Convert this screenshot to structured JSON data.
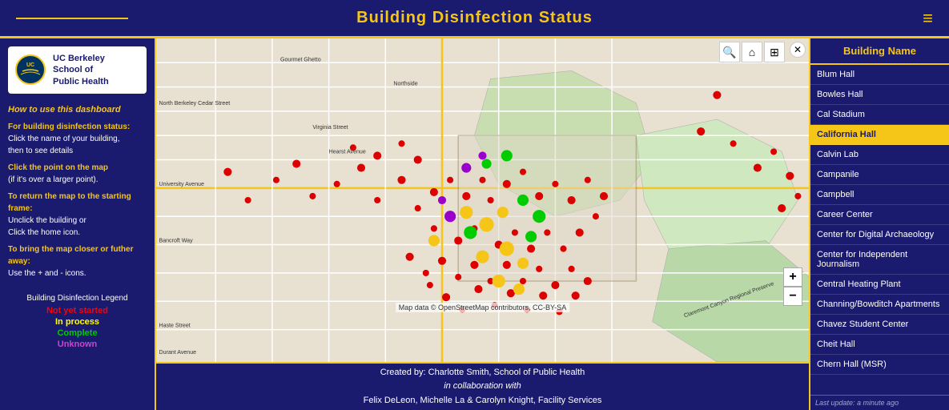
{
  "header": {
    "title": "Building Disinfection Status",
    "hamburger_icon": "≡"
  },
  "left_sidebar": {
    "logo": {
      "line1": "UC Berkeley",
      "line2": "School of",
      "line3": "Public Health"
    },
    "instructions": {
      "heading": "How to use this dashboard",
      "step1_label": "For building disinfection status:",
      "step1_text": "Click the name of  your building,",
      "step1_text2": "then to see details",
      "step2_label": "Click the point on the map",
      "step2_text": "(if it's over a larger point).",
      "step3_label": "To return the map to the starting frame:",
      "step3_text": "Unclick the building or",
      "step3_text2": "Click the home icon.",
      "step4_label": "To bring the map closer or futher away:",
      "step4_text": "Use the + and - icons."
    },
    "legend": {
      "title": "Building Disinfection Legend",
      "items": [
        {
          "label": "Not yet started",
          "color": "red"
        },
        {
          "label": "In process",
          "color": "yellow"
        },
        {
          "label": "Complete",
          "color": "green"
        },
        {
          "label": "Unknown",
          "color": "purple"
        }
      ]
    }
  },
  "map": {
    "attribution": "Map data © OpenStreetMap contributors, CC-BY-SA",
    "zoom_plus": "+",
    "zoom_minus": "−",
    "close_icon": "✕",
    "search_icon": "🔍",
    "home_icon": "⌂",
    "grid_icon": "⊞"
  },
  "footer": {
    "line1": "Created by: Charlotte Smith, School of Public Health",
    "line2": "in collaboration with",
    "line3": "Felix DeLeon, Michelle La & Carolyn Knight, Facility Services"
  },
  "right_sidebar": {
    "header": "Building Name",
    "buildings": [
      {
        "name": "Blum Hall",
        "highlighted": false
      },
      {
        "name": "Bowles Hall",
        "highlighted": false
      },
      {
        "name": "Cal Stadium",
        "highlighted": false
      },
      {
        "name": "California Hall",
        "highlighted": true
      },
      {
        "name": "Calvin Lab",
        "highlighted": false
      },
      {
        "name": "Campanile",
        "highlighted": false
      },
      {
        "name": "Campbell",
        "highlighted": false
      },
      {
        "name": "Career Center",
        "highlighted": false
      },
      {
        "name": "Center for Digital Archaeology",
        "highlighted": false
      },
      {
        "name": "Center for Independent Journalism",
        "highlighted": false
      },
      {
        "name": "Central Heating Plant",
        "highlighted": false
      },
      {
        "name": "Channing/Bowditch Apartments",
        "highlighted": false
      },
      {
        "name": "Chavez Student Center",
        "highlighted": false
      },
      {
        "name": "Cheit Hall",
        "highlighted": false
      },
      {
        "name": "Chern Hall (MSR)",
        "highlighted": false
      }
    ],
    "last_update": "Last update: a minute ago"
  }
}
